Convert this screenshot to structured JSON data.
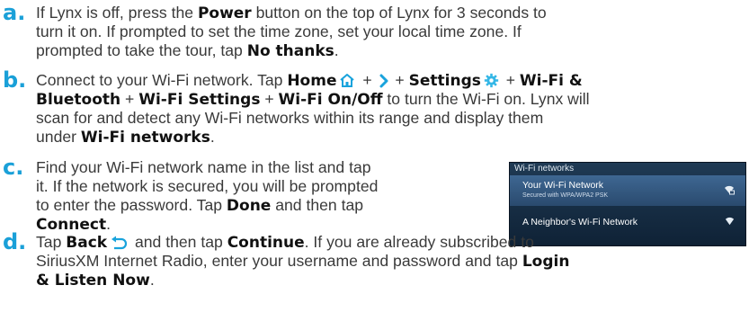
{
  "colors": {
    "letter_accent": "#1aa0d8",
    "home_icon": "#19a3dc",
    "settings_icon": "#35b7e6"
  },
  "steps": {
    "a": {
      "letter": "a.",
      "l1_a": "If Lynx is off, press the ",
      "l1_b": "Power",
      "l1_c": " button on the top of Lynx for 3 seconds to",
      "l2": "turn it on. If prompted to set the time zone, set your local time zone. If",
      "l3_a": "prompted to take the tour, tap ",
      "l3_b": "No thanks",
      "l3_c": "."
    },
    "b": {
      "letter": "b.",
      "l1_a": "Connect to your Wi-Fi network. Tap ",
      "l1_home": "Home",
      "l1_plus1": " + ",
      "l1_plus2": " + ",
      "l1_settings": "Settings",
      "l1_plus3": " + ",
      "l1_wifi": "Wi-Fi &",
      "l2_a": "Bluetooth",
      "l2_b": " + ",
      "l2_c": "Wi-Fi Settings",
      "l2_d": " + ",
      "l2_e": "Wi-Fi On/Off",
      "l2_f": " to turn the Wi-Fi on. Lynx will",
      "l3": "scan for and detect any Wi-Fi networks within its range and display them",
      "l4_a": "under ",
      "l4_b": "Wi-Fi networks",
      "l4_c": "."
    },
    "c": {
      "letter": "c.",
      "l1": "Find your Wi-Fi network name in the list and tap",
      "l2": "it. If the network is secured, you will be prompted",
      "l3_a": "to enter the password. Tap ",
      "l3_b": "Done",
      "l3_c": " and then tap",
      "l4_a": "Connect",
      "l4_b": "."
    },
    "d": {
      "letter": "d.",
      "l1_a": "Tap ",
      "l1_back": "Back",
      "l1_b": " and then tap ",
      "l1_continue": "Continue",
      "l1_c": ". If you are already subscribed to",
      "l2_a": "SiriusXM Internet Radio, enter your username and password and tap ",
      "l2_b": "Login",
      "l3_a": "& Listen Now",
      "l3_b": "."
    }
  },
  "wifi_panel": {
    "header": "Wi-Fi networks",
    "network1_name": "Your Wi-Fi Network",
    "network1_sub": "Secured with WPA/WPA2 PSK",
    "network2_name": "A Neighbor's Wi-Fi Network"
  }
}
